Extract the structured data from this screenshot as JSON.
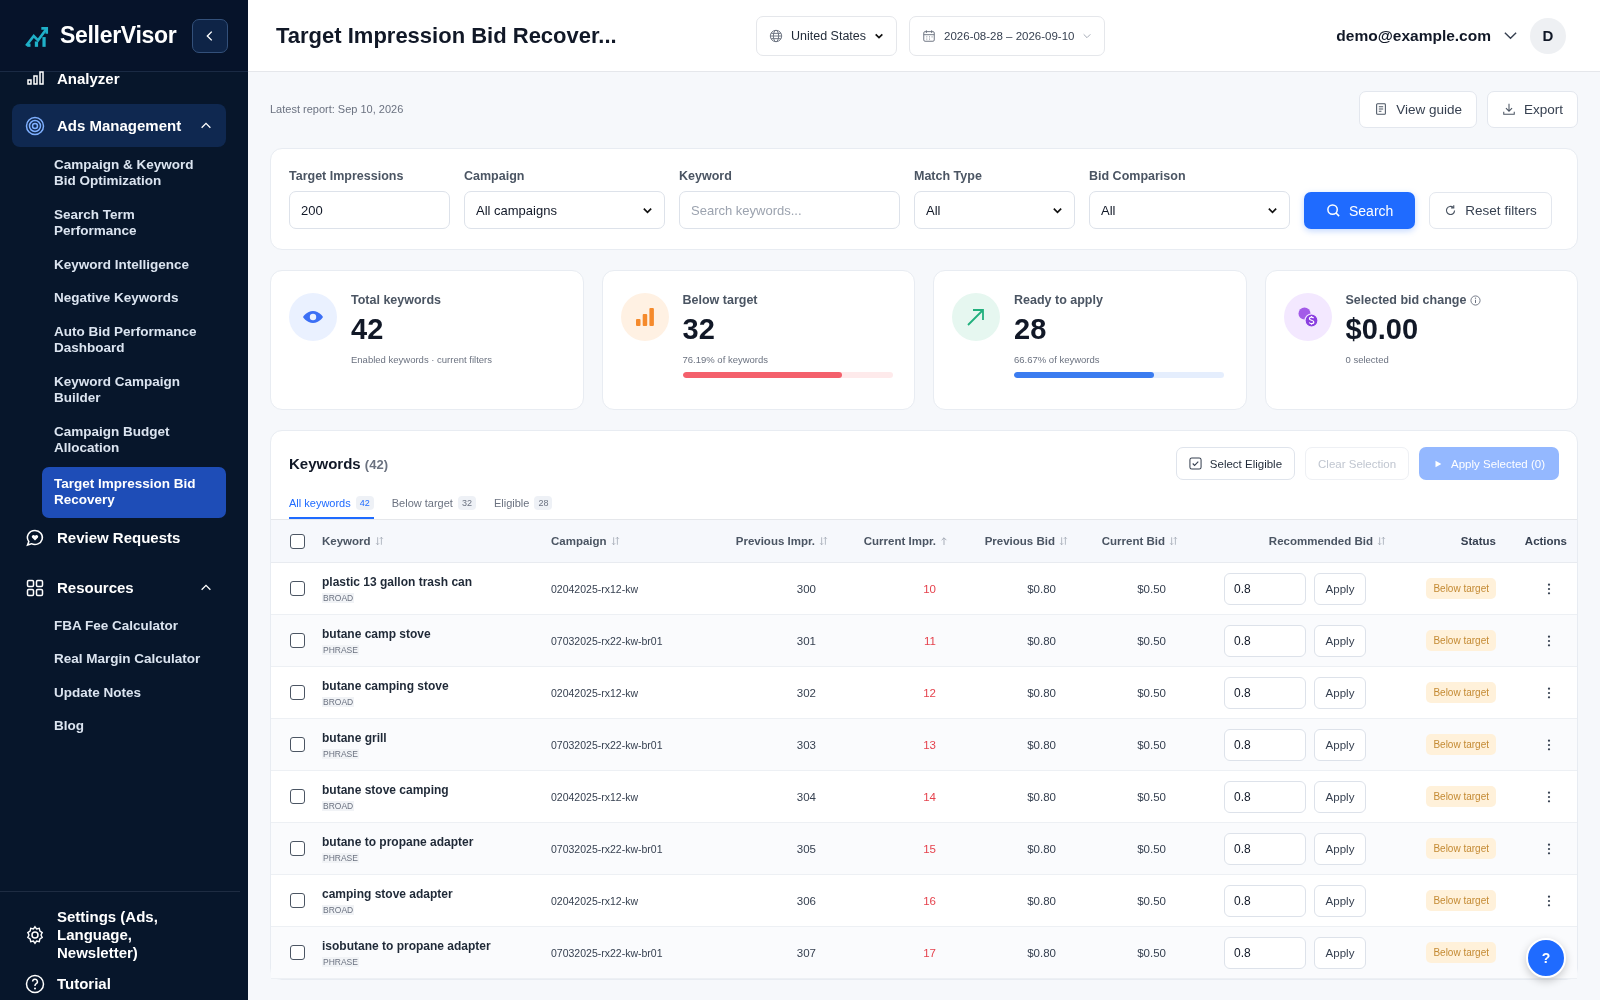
{
  "sidebar": {
    "brand": "SellerVisor",
    "items": [
      {
        "label": "Analyzer",
        "kind": "link"
      },
      {
        "label": "Ads Management",
        "kind": "group",
        "active": true,
        "expanded": true,
        "children": [
          {
            "label": "Campaign & Keyword Bid Optimization",
            "selected": false
          },
          {
            "label": "Search Term Performance",
            "selected": false
          },
          {
            "label": "Keyword Intelligence",
            "selected": false
          },
          {
            "label": "Negative Keywords",
            "selected": false
          },
          {
            "label": "Auto Bid Performance Dashboard",
            "selected": false
          },
          {
            "label": "Keyword Campaign Builder",
            "selected": false
          },
          {
            "label": "Campaign Budget Allocation",
            "selected": false
          },
          {
            "label": "Target Impression Bid Recovery",
            "selected": true
          }
        ]
      },
      {
        "label": "Review Requests",
        "kind": "link"
      },
      {
        "label": "Resources",
        "kind": "group",
        "active": false,
        "expanded": true,
        "children": [
          {
            "label": "FBA Fee Calculator",
            "selected": false
          },
          {
            "label": "Real Margin Calculator",
            "selected": false
          },
          {
            "label": "Update Notes",
            "selected": false
          },
          {
            "label": "Blog",
            "selected": false
          }
        ]
      }
    ],
    "footer": [
      "Settings (Ads, Language, Newsletter)",
      "Tutorial"
    ]
  },
  "header": {
    "title": "Target Impression Bid Recover...",
    "country": "United States",
    "date_range": "2026-08-28 – 2026-09-10",
    "user": "demo@example.com",
    "avatar": "D"
  },
  "latest_report": "Latest report: Sep 10, 2026",
  "page_actions": [
    "View guide",
    "Export"
  ],
  "filters": [
    {
      "label": "Target Impressions",
      "kind": "input",
      "value": "200"
    },
    {
      "label": "Campaign",
      "kind": "select",
      "value": "All campaigns"
    },
    {
      "label": "Keyword",
      "kind": "input",
      "placeholder": "Search keywords..."
    },
    {
      "label": "Match Type",
      "kind": "select",
      "value": "All"
    },
    {
      "label": "Bid Comparison",
      "kind": "select",
      "value": "All"
    }
  ],
  "search_button": "Search",
  "reset_button": "Reset filters",
  "stats": [
    {
      "label": "Total keywords",
      "value": "42",
      "note": "Enabled keywords · current filters",
      "info": false
    },
    {
      "label": "Below target",
      "value": "32",
      "note": "76.19% of keywords",
      "level": 0.7619,
      "color": "#f4606c",
      "info": false
    },
    {
      "label": "Ready to apply",
      "value": "28",
      "note": "66.67% of keywords",
      "level": 0.6667,
      "color": "#3b7cf0",
      "info": false
    },
    {
      "label": "Selected bid change",
      "value": "$0.00",
      "note": "0 selected",
      "info": true
    }
  ],
  "keywords": {
    "title": "Keywords",
    "count": "(42)",
    "buttons": [
      {
        "label": "Select Eligible",
        "kind": "select",
        "disabled": false
      },
      {
        "label": "Clear Selection",
        "kind": "clear",
        "disabled": true
      },
      {
        "label": "Apply Selected (0)",
        "kind": "apply",
        "disabled": true
      }
    ],
    "tabs": [
      {
        "label": "All keywords",
        "count": "42",
        "selected": true
      },
      {
        "label": "Below target",
        "count": "32",
        "selected": false
      },
      {
        "label": "Eligible",
        "count": "28",
        "selected": false
      }
    ],
    "all_checked": false,
    "columns": [
      {
        "label": "Keyword",
        "sortable": true,
        "sorted": false
      },
      {
        "label": "Campaign",
        "sortable": true,
        "sorted": false
      },
      {
        "label": "Previous Impr.",
        "sortable": true,
        "sorted": false
      },
      {
        "label": "Current Impr.",
        "sortable": true,
        "sorted": true
      },
      {
        "label": "Previous Bid",
        "sortable": true,
        "sorted": false
      },
      {
        "label": "Current Bid",
        "sortable": true,
        "sorted": false
      },
      {
        "label": "Recommended Bid",
        "sortable": true,
        "sorted": false
      },
      {
        "label": "Status",
        "sortable": false,
        "sorted": false
      },
      {
        "label": "Actions",
        "sortable": false,
        "sorted": false
      }
    ],
    "rows": [
      {
        "checked": false,
        "keyword": "plastic 13 gallon trash can",
        "match": "BROAD",
        "campaign": "02042025-rx12-kw",
        "prev_impr": "300",
        "cur_impr": "10",
        "below": true,
        "prev_bid": "$0.80",
        "cur_bid": "$0.50",
        "rec_bid": "0.8",
        "apply": "Apply",
        "status": "Below target"
      },
      {
        "checked": false,
        "keyword": "butane camp stove",
        "match": "PHRASE",
        "campaign": "07032025-rx22-kw-br01",
        "prev_impr": "301",
        "cur_impr": "11",
        "below": true,
        "prev_bid": "$0.80",
        "cur_bid": "$0.50",
        "rec_bid": "0.8",
        "apply": "Apply",
        "status": "Below target"
      },
      {
        "checked": false,
        "keyword": "butane camping stove",
        "match": "BROAD",
        "campaign": "02042025-rx12-kw",
        "prev_impr": "302",
        "cur_impr": "12",
        "below": true,
        "prev_bid": "$0.80",
        "cur_bid": "$0.50",
        "rec_bid": "0.8",
        "apply": "Apply",
        "status": "Below target"
      },
      {
        "checked": false,
        "keyword": "butane grill",
        "match": "PHRASE",
        "campaign": "07032025-rx22-kw-br01",
        "prev_impr": "303",
        "cur_impr": "13",
        "below": true,
        "prev_bid": "$0.80",
        "cur_bid": "$0.50",
        "rec_bid": "0.8",
        "apply": "Apply",
        "status": "Below target"
      },
      {
        "checked": false,
        "keyword": "butane stove camping",
        "match": "BROAD",
        "campaign": "02042025-rx12-kw",
        "prev_impr": "304",
        "cur_impr": "14",
        "below": true,
        "prev_bid": "$0.80",
        "cur_bid": "$0.50",
        "rec_bid": "0.8",
        "apply": "Apply",
        "status": "Below target"
      },
      {
        "checked": false,
        "keyword": "butane to propane adapter",
        "match": "PHRASE",
        "campaign": "07032025-rx22-kw-br01",
        "prev_impr": "305",
        "cur_impr": "15",
        "below": true,
        "prev_bid": "$0.80",
        "cur_bid": "$0.50",
        "rec_bid": "0.8",
        "apply": "Apply",
        "status": "Below target"
      },
      {
        "checked": false,
        "keyword": "camping stove adapter",
        "match": "BROAD",
        "campaign": "02042025-rx12-kw",
        "prev_impr": "306",
        "cur_impr": "16",
        "below": true,
        "prev_bid": "$0.80",
        "cur_bid": "$0.50",
        "rec_bid": "0.8",
        "apply": "Apply",
        "status": "Below target"
      },
      {
        "checked": false,
        "keyword": "isobutane to propane adapter",
        "match": "PHRASE",
        "campaign": "07032025-rx22-kw-br01",
        "prev_impr": "307",
        "cur_impr": "17",
        "below": true,
        "prev_bid": "$0.80",
        "cur_bid": "$0.50",
        "rec_bid": "0.8",
        "apply": "Apply",
        "status": "Below target"
      }
    ]
  },
  "help_button": "?"
}
